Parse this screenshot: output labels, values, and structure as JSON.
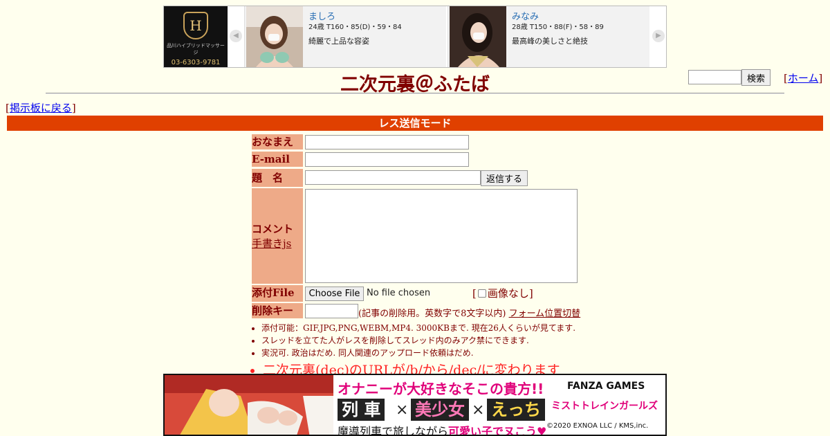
{
  "top_ad": {
    "shop_name": "品川ハイブリッドマッサージ",
    "phone": "03-6303-9781",
    "crest_letter": "H",
    "cards": [
      {
        "name": "ましろ",
        "stats": "24歳 T160・85(D)・59・84",
        "desc": "綺麗で上品な容姿"
      },
      {
        "name": "みなみ",
        "stats": "28歳 T150・88(F)・58・89",
        "desc": "最高峰の美しさと絶技"
      }
    ],
    "arrow_prev": "◀",
    "arrow_next": "▶"
  },
  "header": {
    "title": "二次元裏＠ふたば",
    "search_button": "検索",
    "home_link": "ホーム",
    "bracket_open": "[",
    "bracket_close": "]"
  },
  "back_link": "掲示板に戻る",
  "mode_bar": "レス送信モード",
  "form": {
    "name_label": "おなまえ",
    "email_label": "E-mail",
    "subject_label": "題　名",
    "submit_button": "返信する",
    "comment_label": "コメント",
    "handwriting_link": "手書きjs",
    "file_label": "添付File",
    "choose_file_button": "Choose File",
    "file_status": "No file chosen",
    "no_image_label": "画像なし",
    "delete_key_label": "削除キー",
    "delete_key_note": "(記事の削除用。英数字で8文字以内)",
    "form_position_link": "フォーム位置切替"
  },
  "notes": [
    "添付可能：GIF,JPG,PNG,WEBM,MP4. 3000KBまで. 現在26人くらいが見てます.",
    "スレッドを立てた人がレスを削除してスレッド内のみアク禁にできます.",
    "実況可. 政治はだめ. 同人関連のアップロード依頼はだめ."
  ],
  "notice": "二次元裏(dec)のURLが/b/から/dec/に変わります",
  "bottom_ad": {
    "headline": "オナニーが大好きなそこの貴方!!",
    "brand": "FANZA GAMES",
    "words": [
      "列 車",
      "美少女",
      "えっち"
    ],
    "times": "×",
    "game_logo": "ミストトレインガールズ",
    "sub_plain": "魔導列車で旅しながら",
    "sub_pink": "可愛い子でヌこう♥",
    "copyright": "©2020 EXNOA LLC / KMS,inc."
  },
  "colors": {
    "background": "#ffffee",
    "text": "#800000",
    "label_bg": "#eeaa88",
    "mode_bar": "#e04000",
    "notice": "#ff2222"
  }
}
